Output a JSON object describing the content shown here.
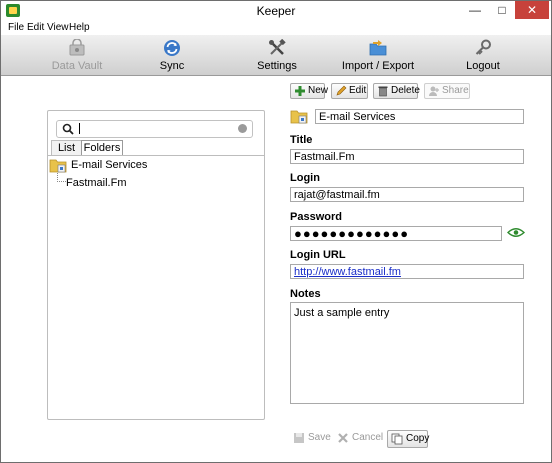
{
  "window": {
    "title": "Keeper",
    "minimize": "—",
    "maximize": "□",
    "close": "✕"
  },
  "menu": [
    "File",
    "Edit",
    "View",
    "Help"
  ],
  "toolbar": [
    {
      "label": "Data Vault",
      "icon": "vault-icon",
      "enabled": false
    },
    {
      "label": "Sync",
      "icon": "sync-icon",
      "enabled": true
    },
    {
      "label": "Settings",
      "icon": "settings-tools-icon",
      "enabled": true
    },
    {
      "label": "Import / Export",
      "icon": "import-export-folder-icon",
      "enabled": true
    },
    {
      "label": "Logout",
      "icon": "key-icon",
      "enabled": true
    }
  ],
  "sidebar": {
    "search": {
      "value": "",
      "placeholder": ""
    },
    "tabs": [
      {
        "label": "List",
        "selected": false
      },
      {
        "label": "Folders",
        "selected": true
      }
    ],
    "tree": {
      "root": "E-mail Services",
      "children": [
        "Fastmail.Fm"
      ]
    }
  },
  "actions": {
    "new": "New",
    "edit": "Edit",
    "delete": "Delete",
    "share": "Share"
  },
  "record": {
    "folder": "E-mail Services",
    "title_label": "Title",
    "title": "Fastmail.Fm",
    "login_label": "Login",
    "login": "rajat@fastmail.fm",
    "password_label": "Password",
    "password_mask": "●●●●●●●●●●●●●",
    "url_label": "Login URL",
    "url": "http://www.fastmail.fm",
    "notes_label": "Notes",
    "notes": "Just a sample entry"
  },
  "footer": {
    "save": "Save",
    "cancel": "Cancel",
    "copy": "Copy"
  },
  "colors": {
    "accent_green": "#2e8b2e",
    "link_blue": "#1a2ec8",
    "close_red": "#c7423b",
    "toolbar_top": "#f0f0f0",
    "toolbar_bottom": "#cfcfcf"
  }
}
